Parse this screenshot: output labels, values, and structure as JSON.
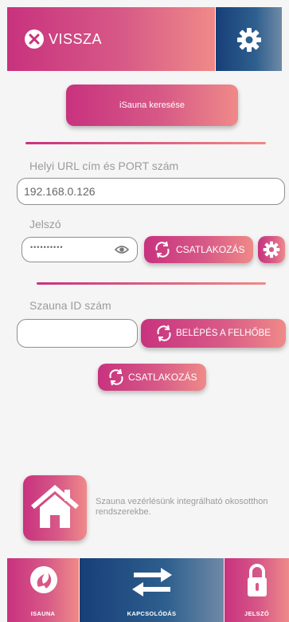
{
  "header": {
    "back_label": "VISSZA"
  },
  "search_button_label": "iSauna keresése",
  "local": {
    "url_label": "Helyi URL cím és PORT szám",
    "url_value": "192.168.0.126",
    "password_label": "Jelszó",
    "password_value": "••••••••••",
    "connect_label": "CSATLAKOZÁS"
  },
  "cloud": {
    "id_label": "Szauna ID szám",
    "id_value": "",
    "login_label": "BELÉPÉS A FELHŐBE",
    "connect_label": "CSATLAKOZÁS"
  },
  "smart_home": {
    "text": "Szauna vezérlésünk integrálható okosotthon rendszerekbe."
  },
  "nav": {
    "items": [
      {
        "label": "ISAUNA",
        "icon": "isauna-logo-icon"
      },
      {
        "label": "KAPCSOLÓDÁS",
        "icon": "swap-arrows-icon"
      },
      {
        "label": "JELSZÓ",
        "icon": "lock-icon"
      }
    ]
  },
  "colors": {
    "accent_start": "#c8327e",
    "accent_end": "#ef8a88",
    "nav_blue": "#173f78",
    "background": "#f5f5f5"
  }
}
